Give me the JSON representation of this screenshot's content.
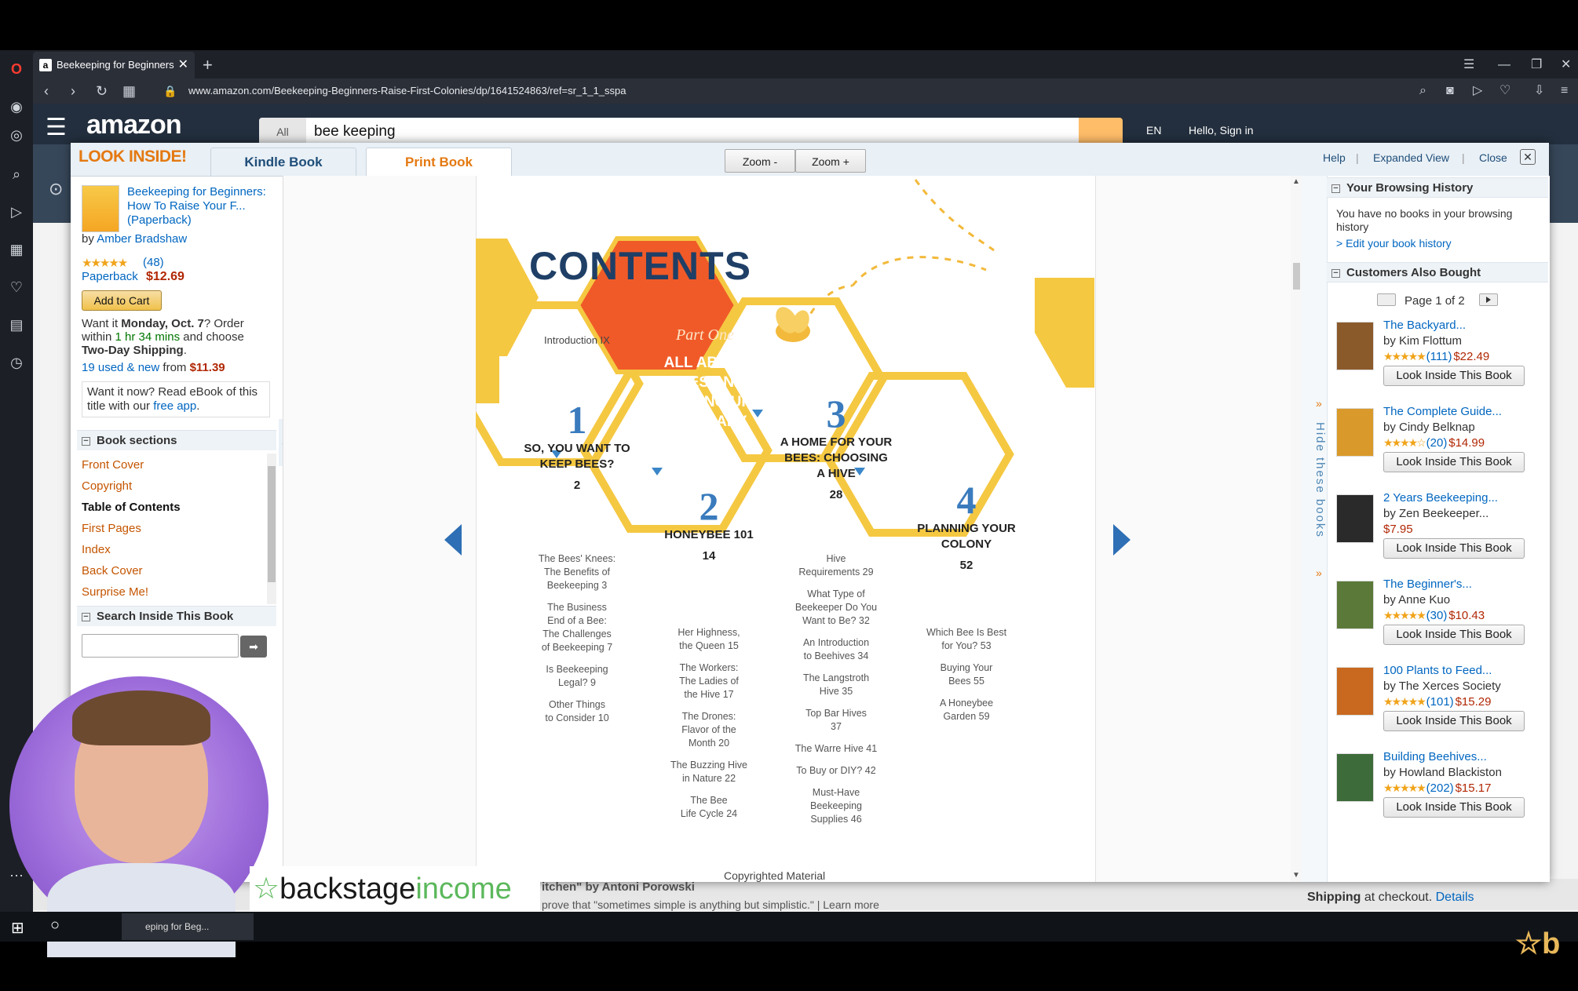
{
  "browser": {
    "tab_title": "Beekeeping for Beginners:",
    "tab_icon": "a",
    "url": "www.amazon.com/Beekeeping-Beginners-Raise-First-Colonies/dp/1641524863/ref=sr_1_1_sspa"
  },
  "amazon": {
    "logo": "amazon",
    "search_scope": "All",
    "search_query": "bee keeping",
    "lang": "EN",
    "greeting": "Hello, Sign in",
    "bottom_text_1": "itchen\" by Antoni Porowski",
    "bottom_text_2": "prove that \"sometimes simple is anything but simplistic.\" | Learn more",
    "shipping_label": "Shipping",
    "shipping_rest": " at checkout. ",
    "shipping_link": "Details"
  },
  "look_inside": {
    "logo": "LOOK INSIDE!",
    "tabs": [
      "Kindle Book",
      "Print Book"
    ],
    "zoom_out": "Zoom -",
    "zoom_in": "Zoom +",
    "help": "Help",
    "expanded": "Expanded View",
    "close": "Close"
  },
  "book": {
    "title": "Beekeeping for Beginners: How To Raise Your F... (Paperback)",
    "by": "by ",
    "author": "Amber Bradshaw",
    "stars": "★★★★★",
    "rating_count": "(48)",
    "format": "Paperback",
    "price": "$12.69",
    "add_to_cart": "Add to Cart",
    "delivery_pre": "Want it ",
    "delivery_day": "Monday, Oct. 7",
    "delivery_mid": "? Order within ",
    "delivery_time": "1 hr 34 mins",
    "delivery_post": " and choose ",
    "delivery_ship": "Two-Day Shipping",
    "delivery_end": ".",
    "used_new": "19 used & new",
    "used_from": " from ",
    "used_price": "$11.39",
    "ebook_text": "Want it now? Read eBook of this title with our ",
    "ebook_link": "free app",
    "ebook_end": "."
  },
  "sections": {
    "heading": "Book sections",
    "items": [
      "Front Cover",
      "Copyright",
      "Table of Contents",
      "First Pages",
      "Index",
      "Back Cover",
      "Surprise Me!"
    ],
    "search_heading": "Search Inside This Book",
    "search_go": "➡"
  },
  "reader": {
    "copyright": "Copyrighted Material",
    "contents_title": "CONTENTS",
    "intro": "Introduction  IX",
    "part_one_script": "Part One",
    "part_one_lines": [
      "ALL ABOUT",
      "BEES AND",
      "SETTING UP",
      "AN APIARY"
    ],
    "chapters": [
      {
        "num": "1",
        "lines": [
          "SO, YOU WANT TO",
          "KEEP BEES?"
        ],
        "page": "2",
        "entries": [
          "The Bees' Knees:",
          "The Benefits of",
          "Beekeeping  3",
          "",
          "The Business",
          "End of a Bee:",
          "The Challenges",
          "of Beekeeping  7",
          "",
          "Is Beekeeping",
          "Legal?  9",
          "",
          "Other Things",
          "to Consider  10"
        ]
      },
      {
        "num": "2",
        "lines": [
          "HONEYBEE 101"
        ],
        "page": "14",
        "entries": [
          "Her Highness,",
          "the Queen  15",
          "",
          "The Workers:",
          "The Ladies of",
          "the Hive  17",
          "",
          "The Drones:",
          "Flavor of the",
          "Month  20",
          "",
          "The Buzzing Hive",
          "in Nature  22",
          "",
          "The Bee",
          "Life Cycle  24"
        ]
      },
      {
        "num": "3",
        "lines": [
          "A HOME FOR YOUR",
          "BEES: CHOOSING",
          "A HIVE"
        ],
        "page": "28",
        "entries": [
          "Hive",
          "Requirements  29",
          "",
          "What Type of",
          "Beekeeper Do You",
          "Want to Be?  32",
          "",
          "An Introduction",
          "to Beehives  34",
          "",
          "The Langstroth",
          "Hive  35",
          "",
          "Top Bar Hives",
          "37",
          "",
          "The Warre Hive  41",
          "",
          "To Buy or DIY?  42",
          "",
          "Must-Have",
          "Beekeeping",
          "Supplies  46"
        ]
      },
      {
        "num": "4",
        "lines": [
          "PLANNING YOUR",
          "COLONY"
        ],
        "page": "52",
        "entries": [
          "Which Bee Is Best",
          "for You?  53",
          "",
          "Buying Your",
          "Bees  55",
          "",
          "A Honeybee",
          "Garden  59"
        ]
      }
    ]
  },
  "hide_books": "Hide these books",
  "history": {
    "heading": "Your Browsing History",
    "text": "You have no books in your browsing history",
    "link": "> Edit your book history"
  },
  "also_bought": {
    "heading": "Customers Also Bought",
    "pager": "Page 1 of 2",
    "button_label": "Look Inside This Book",
    "books": [
      {
        "title": "The Backyard...",
        "author": "by Kim Flottum",
        "stars": "★★★★★",
        "count": "(111)",
        "price": "$22.49",
        "color": "#8b5a2b"
      },
      {
        "title": "The Complete Guide...",
        "author": "by Cindy Belknap",
        "stars": "★★★★☆",
        "count": "(20)",
        "price": "$14.99",
        "color": "#d99a2b"
      },
      {
        "title": "2 Years Beekeeping...",
        "author": "by Zen Beekeeper...",
        "stars": "",
        "count": "",
        "price": "$7.95",
        "color": "#2a2a2a"
      },
      {
        "title": "The Beginner's...",
        "author": "by Anne Kuo",
        "stars": "★★★★★",
        "count": "(30)",
        "price": "$10.43",
        "color": "#5b7a3a"
      },
      {
        "title": "100 Plants to Feed...",
        "author": "by The Xerces Society",
        "stars": "★★★★★",
        "count": "(101)",
        "price": "$15.29",
        "color": "#c8691f"
      },
      {
        "title": "Building Beehives...",
        "author": "by Howland Blackiston",
        "stars": "★★★★★",
        "count": "(202)",
        "price": "$15.17",
        "color": "#3d6b3a"
      }
    ]
  },
  "overlay": {
    "brand_a": "backstage",
    "brand_b": "income",
    "taskbar_app": "eping for Beg..."
  }
}
